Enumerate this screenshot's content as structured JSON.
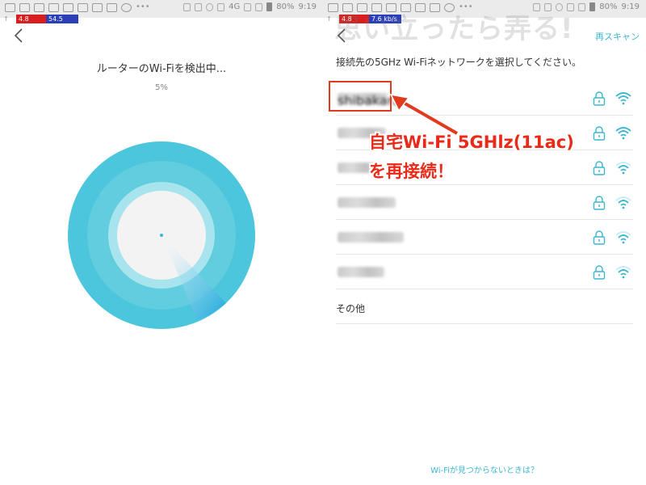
{
  "left": {
    "statusbar": {
      "speed_left": "4.8 Mbps",
      "speed_right": "54.5 kb/s",
      "network": "4G",
      "battery": "80%",
      "time": "9:19"
    },
    "title": "ルーターのWi-Fiを検出中...",
    "progress_text": "5%",
    "progress": 0.05
  },
  "right": {
    "statusbar": {
      "speed_left": "4.8 Mbps",
      "speed_right": "7.6 kb/s",
      "battery": "80%",
      "time": "9:19"
    },
    "watermark": "思い立ったら弄る!",
    "rescan": "再スキャン",
    "prompt": "接続先の5GHz Wi-Fiネットワークを選択してください。",
    "networks": [
      {
        "name": "shibakara",
        "secured": true,
        "signal": "strong"
      },
      {
        "name": "",
        "secured": true,
        "signal": "strong"
      },
      {
        "name": "",
        "secured": true,
        "signal": "medium"
      },
      {
        "name": "",
        "secured": true,
        "signal": "medium"
      },
      {
        "name": "",
        "secured": true,
        "signal": "medium"
      },
      {
        "name": "",
        "secured": true,
        "signal": "medium"
      }
    ],
    "other": "その他",
    "help": "Wi-Fiが見つからないときは？"
  },
  "annotation": {
    "line1": "自宅Wi-Fi 5GHlz(11ac)",
    "line2": "を再接続！"
  },
  "colors": {
    "accent": "#3bb7cf",
    "radar_outer": "#4cc6dc",
    "radar_mid": "#78d3e4",
    "radar_inner": "#a7e4ee",
    "annotation_red": "#ea2a18"
  }
}
